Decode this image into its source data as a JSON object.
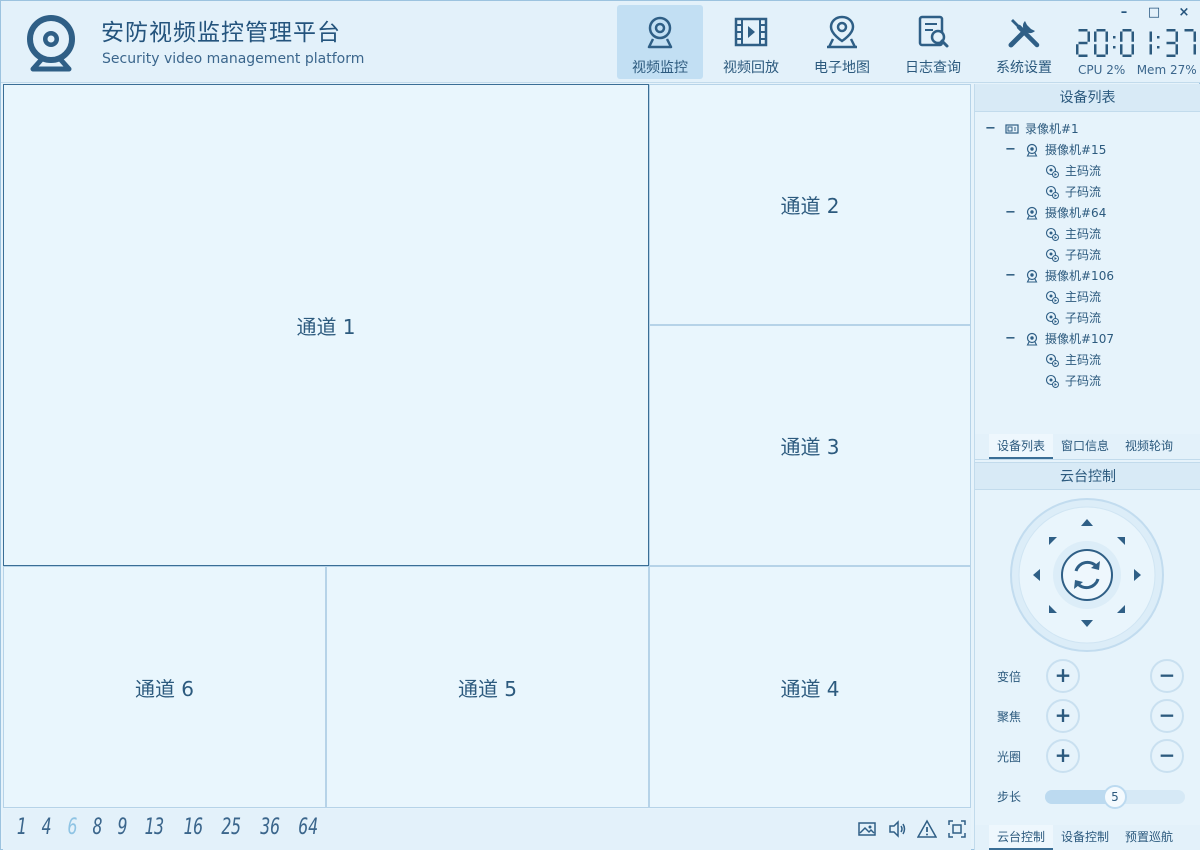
{
  "app": {
    "title": "安防视频监控管理平台",
    "subtitle": "Security video management platform"
  },
  "nav": [
    {
      "label": "视频监控",
      "icon": "camera-icon",
      "active": true
    },
    {
      "label": "视频回放",
      "icon": "film-icon",
      "active": false
    },
    {
      "label": "电子地图",
      "icon": "map-pin-icon",
      "active": false
    },
    {
      "label": "日志查询",
      "icon": "log-search-icon",
      "active": false
    },
    {
      "label": "系统设置",
      "icon": "tools-icon",
      "active": false
    }
  ],
  "clock": "20:01:37",
  "sysinfo": {
    "cpu": "CPU 2%",
    "mem": "Mem 27%"
  },
  "window_controls": {
    "minimize": "–",
    "maximize": "□",
    "close": "×"
  },
  "channels": [
    "通道 1",
    "通道 2",
    "通道 3",
    "通道 4",
    "通道 5",
    "通道 6"
  ],
  "layouts": [
    {
      "label": "1",
      "active": false
    },
    {
      "label": "4",
      "active": false
    },
    {
      "label": "6",
      "active": true
    },
    {
      "label": "8",
      "active": false
    },
    {
      "label": "9",
      "active": false
    },
    {
      "label": "13",
      "active": false
    },
    {
      "label": "16",
      "active": false
    },
    {
      "label": "25",
      "active": false
    },
    {
      "label": "36",
      "active": false
    },
    {
      "label": "64",
      "active": false
    }
  ],
  "bottom_tools": [
    "picture-icon",
    "speaker-icon",
    "alarm-icon",
    "fullscreen-icon"
  ],
  "device_panel": {
    "title": "设备列表",
    "tree": [
      {
        "level": 0,
        "label": "录像机#1",
        "type": "recorder",
        "toggle": "−"
      },
      {
        "level": 1,
        "label": "摄像机#15",
        "type": "camera",
        "toggle": "−"
      },
      {
        "level": 2,
        "label": "主码流",
        "type": "stream"
      },
      {
        "level": 2,
        "label": "子码流",
        "type": "stream"
      },
      {
        "level": 1,
        "label": "摄像机#64",
        "type": "camera",
        "toggle": "−"
      },
      {
        "level": 2,
        "label": "主码流",
        "type": "stream"
      },
      {
        "level": 2,
        "label": "子码流",
        "type": "stream"
      },
      {
        "level": 1,
        "label": "摄像机#106",
        "type": "camera",
        "toggle": "−"
      },
      {
        "level": 2,
        "label": "主码流",
        "type": "stream"
      },
      {
        "level": 2,
        "label": "子码流",
        "type": "stream"
      },
      {
        "level": 1,
        "label": "摄像机#107",
        "type": "camera",
        "toggle": "−"
      },
      {
        "level": 2,
        "label": "主码流",
        "type": "stream"
      },
      {
        "level": 2,
        "label": "子码流",
        "type": "stream"
      }
    ],
    "tabs": [
      {
        "label": "设备列表",
        "active": true
      },
      {
        "label": "窗口信息",
        "active": false
      },
      {
        "label": "视频轮询",
        "active": false
      }
    ]
  },
  "ptz": {
    "title": "云台控制",
    "rows": [
      {
        "label": "变倍",
        "plus": "+",
        "minus": "−"
      },
      {
        "label": "聚焦",
        "plus": "+",
        "minus": "−"
      },
      {
        "label": "光圈",
        "plus": "+",
        "minus": "−"
      }
    ],
    "step": {
      "label": "步长",
      "value": "5",
      "fraction": 0.5
    },
    "tabs": [
      {
        "label": "云台控制",
        "active": true
      },
      {
        "label": "设备控制",
        "active": false
      },
      {
        "label": "预置巡航",
        "active": false
      }
    ]
  },
  "colors": {
    "accent": "#2c5a7e",
    "active_layout": "#8fc4e4",
    "background": "#e6f3fb"
  }
}
